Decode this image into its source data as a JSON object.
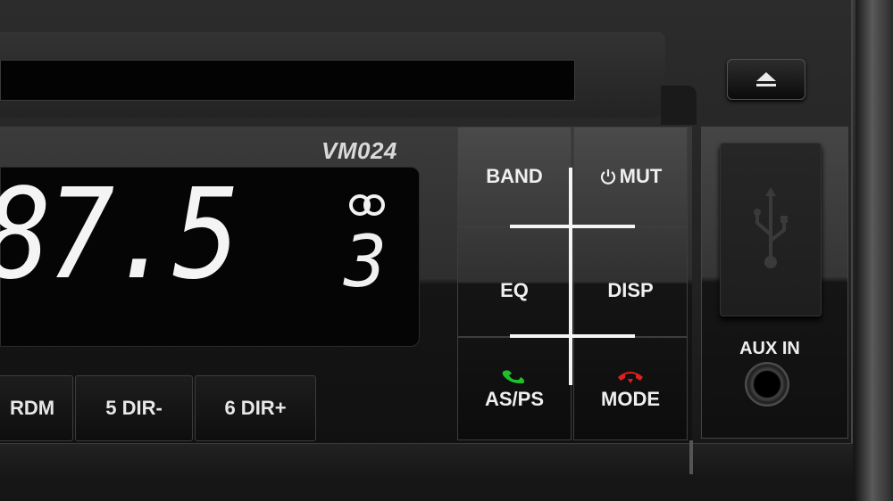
{
  "unit": {
    "model": "VM024",
    "frequency": "87.5",
    "preset_indicator": "3"
  },
  "preset_buttons": [
    {
      "label": "RDM"
    },
    {
      "label": "5 DIR-"
    },
    {
      "label": "6 DIR+"
    }
  ],
  "controls": {
    "band": "BAND",
    "mute": "MUT",
    "eq": "EQ",
    "disp": "DISP",
    "asps": "AS/PS",
    "mode": "MODE"
  },
  "aux": {
    "label": "AUX IN"
  },
  "colors": {
    "answer_phone": "#1fbf2a",
    "hangup_phone": "#e02020",
    "display_text": "#f4f4f4"
  },
  "icons": [
    "eject-icon",
    "power-icon",
    "stereo-icon",
    "usb-icon",
    "phone-answer-icon",
    "phone-hangup-icon"
  ]
}
